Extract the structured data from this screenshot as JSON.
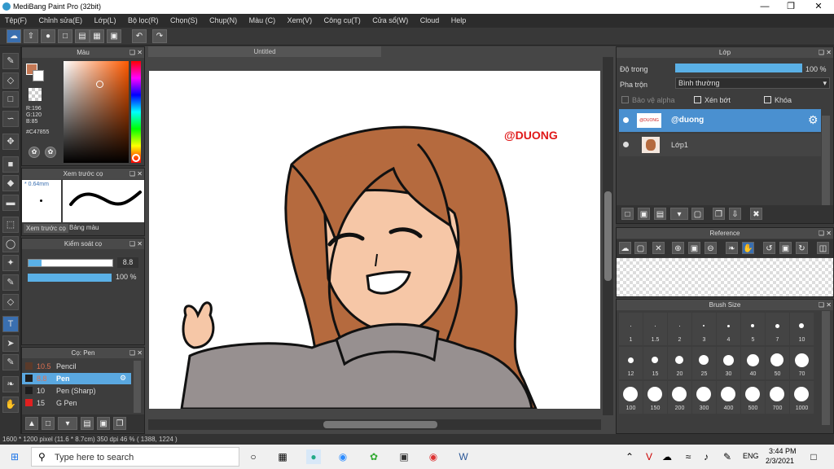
{
  "window": {
    "title": "MediBang Paint Pro (32bit)"
  },
  "menu": [
    "Tệp(F)",
    "Chỉnh sửa(E)",
    "Lớp(L)",
    "Bộ lọc(R)",
    "Chọn(S)",
    "Chụp(N)",
    "Màu (C)",
    "Xem(V)",
    "Công cụ(T)",
    "Cửa sổ(W)",
    "Cloud",
    "Help"
  ],
  "color_panel": {
    "title": "Màu",
    "r": "R:196",
    "g": "G:120",
    "b": "B:85",
    "hex": "#C47855",
    "primary": "#C47855"
  },
  "brush_preview": {
    "title": "Xem trước cọ",
    "size": "* 0.64mm",
    "tab1": "Xem trước cọ",
    "tab2": "Bảng màu"
  },
  "brush_control": {
    "title": "Kiểm soát cọ",
    "size": "8.8",
    "opacity": "100 %"
  },
  "brush_list": {
    "title": "Cọ: Pen",
    "items": [
      {
        "size": "10.5",
        "name": "Pencil",
        "color": "#5a3a2a"
      },
      {
        "size": "8.8",
        "name": "Pen",
        "color": "#1e1e1e"
      },
      {
        "size": "10",
        "name": "Pen (Sharp)",
        "color": "#1e1e1e"
      },
      {
        "size": "15",
        "name": "G Pen",
        "color": "#e02020"
      }
    ]
  },
  "document": {
    "tab": "Untitled",
    "watermark": "@DUONG"
  },
  "layers": {
    "title": "Lớp",
    "opacity_label": "Độ trong",
    "opacity_value": "100 %",
    "blend_label": "Pha trộn",
    "blend_value": "Bình thường",
    "protect_alpha": "Bảo vệ alpha",
    "clip": "Xén bớt",
    "lock": "Khóa",
    "items": [
      {
        "name": "@duong",
        "selected": true
      },
      {
        "name": "Lớp1",
        "selected": false
      }
    ]
  },
  "reference": {
    "title": "Reference"
  },
  "brush_size": {
    "title": "Brush Size",
    "sizes": [
      "1",
      "1.5",
      "2",
      "3",
      "4",
      "5",
      "7",
      "10",
      "12",
      "15",
      "20",
      "25",
      "30",
      "40",
      "50",
      "70",
      "100",
      "150",
      "200",
      "300",
      "400",
      "500",
      "700",
      "1000"
    ]
  },
  "status": {
    "text": "1600 * 1200 pixel  (11.6 * 8.7cm)  350 dpi  46 %  ( 1388, 1224 )"
  },
  "taskbar": {
    "search": "Type here to search",
    "lang": "ENG",
    "time": "3:44 PM",
    "date": "2/3/2021"
  }
}
